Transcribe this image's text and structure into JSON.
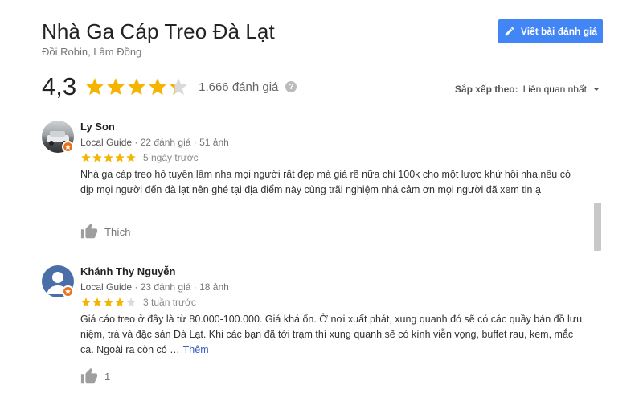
{
  "place": {
    "title": "Nhà Ga Cáp Treo Đà Lạt",
    "subtitle": "Đồi Robin, Lâm Đồng"
  },
  "write_review_label": "Viết bài đánh giá",
  "rating": {
    "value": "4,3",
    "stars": 4.3,
    "count_text": "1.666 đánh giá",
    "help_glyph": "?"
  },
  "sort": {
    "label": "Sắp xếp theo:",
    "value": "Liên quan nhất"
  },
  "reviews": [
    {
      "name": "Ly Son",
      "guide": "Local Guide",
      "stats": " · 22 đánh giá · 51 ảnh",
      "stars": 5,
      "time": "5 ngày trước",
      "text": "Nhà ga cáp treo hồ tuyền lâm nha mọi người rất đẹp mà giá rẽ nữa chỉ 100k cho một lược khứ hồi nha.nếu có dịp mọi người đến đà lạt nên ghé tại địa điểm này cùng trãi nghiệm nhá cảm ơn mọi người đã xem tin ạ",
      "more": "",
      "like_text": "Thích"
    },
    {
      "name": "Khánh Thy Nguyễn",
      "guide": "Local Guide",
      "stats": " · 23 đánh giá · 18 ảnh",
      "stars": 4,
      "time": "3 tuần trước",
      "text": "Giá cáo treo ở đây là từ 80.000-100.000. Giá khá ổn. Ở nơi xuất phát, xung quanh đó sẽ có các quầy bán đồ lưu niệm, trà và đặc sản Đà Lạt. Khi các bạn đã tới trạm thì xung quanh sẽ có kính viễn vọng, buffet rau, kem, mắc ca. Ngoài ra còn có …",
      "more": "Thêm",
      "like_text": "1"
    }
  ],
  "colors": {
    "star_filled": "#f4b400",
    "star_empty": "#dadada",
    "button_blue": "#4285f4",
    "badge_orange": "#e8711c",
    "link_blue": "#3b5fbf"
  },
  "icons": {
    "write": "pencil-icon",
    "help": "help-icon",
    "sort": "chevron-down-icon",
    "like": "thumbs-up-icon",
    "badge": "local-guide-star-icon",
    "avatar": "user-avatar-icon"
  }
}
